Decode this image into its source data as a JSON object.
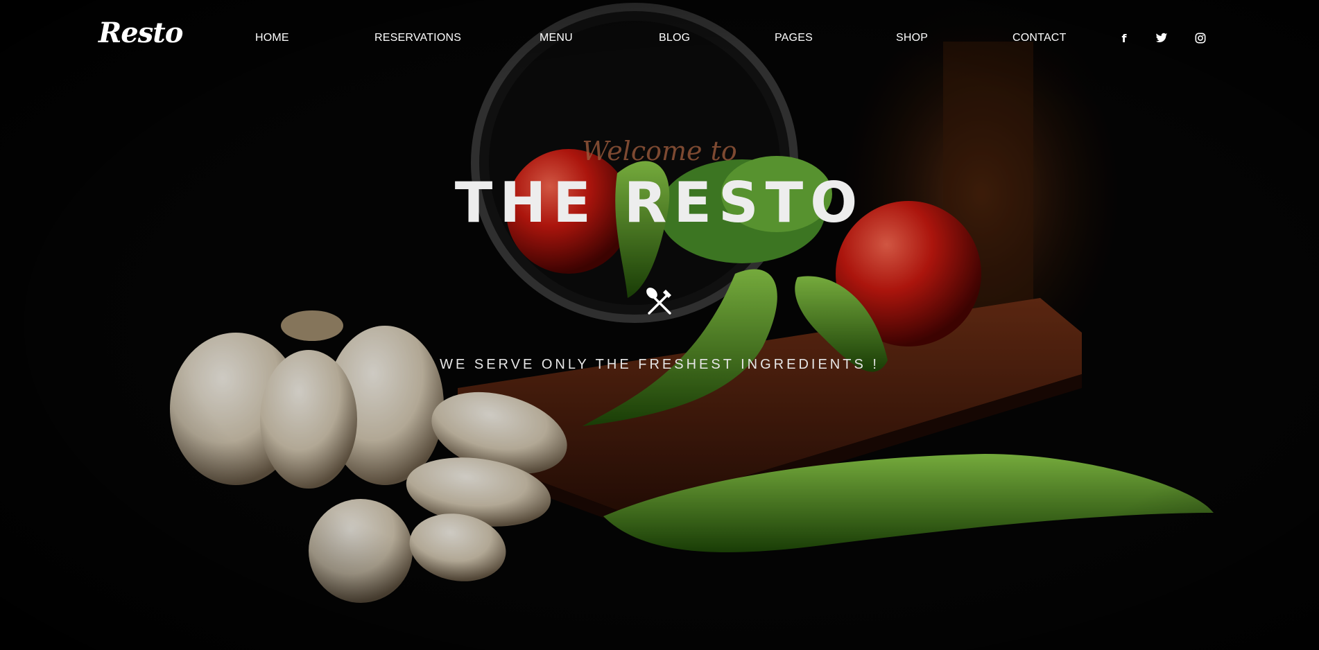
{
  "brand": {
    "logo_text": "Resto"
  },
  "nav": {
    "items": [
      {
        "label": "HOME"
      },
      {
        "label": "RESERVATIONS"
      },
      {
        "label": "MENU"
      },
      {
        "label": "BLOG"
      },
      {
        "label": "PAGES"
      },
      {
        "label": "SHOP"
      },
      {
        "label": "CONTACT"
      }
    ],
    "social": [
      {
        "icon": "facebook-icon",
        "glyph": "f"
      },
      {
        "icon": "twitter-icon"
      },
      {
        "icon": "instagram-icon"
      }
    ]
  },
  "hero": {
    "welcome": "Welcome to",
    "title": "THE RESTO",
    "divider_icon": "spoon-knife-icon",
    "tagline": "WE SERVE ONLY THE FRESHEST INGREDIENTS !"
  },
  "colors": {
    "background": "#050505",
    "welcome_accent": "#9b5a3c",
    "title": "#ededed"
  }
}
